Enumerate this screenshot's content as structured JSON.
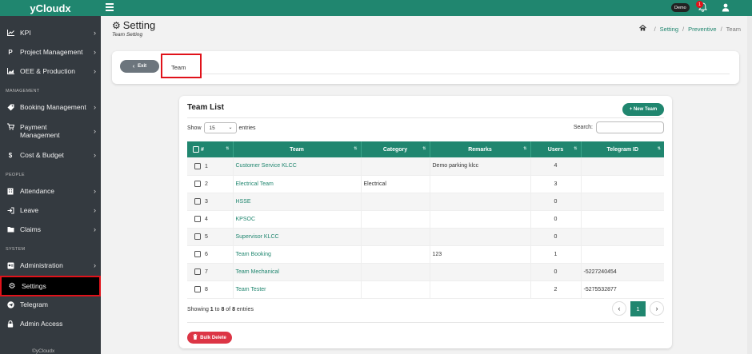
{
  "app": {
    "brand": "yCloudx",
    "footer": "©yCloudx"
  },
  "topbar": {
    "demo_label": "Demo",
    "notification_count": "1"
  },
  "sidebar": {
    "items": [
      {
        "label": "KPI",
        "icon": "chart-line-icon",
        "chevron": true
      },
      {
        "label": "Project Management",
        "icon": "parking-icon",
        "chevron": true
      },
      {
        "label": "OEE & Production",
        "icon": "chart-area-icon",
        "chevron": true
      },
      {
        "label": "Booking Management",
        "icon": "tag-icon",
        "chevron": true
      },
      {
        "label": "Payment Management",
        "icon": "cart-icon",
        "chevron": true
      },
      {
        "label": "Cost & Budget",
        "icon": "dollar-icon",
        "chevron": true
      },
      {
        "label": "Attendance",
        "icon": "building-icon",
        "chevron": true
      },
      {
        "label": "Leave",
        "icon": "login-icon",
        "chevron": true
      },
      {
        "label": "Claims",
        "icon": "folder-icon",
        "chevron": true
      },
      {
        "label": "Administration",
        "icon": "id-card-icon",
        "chevron": true
      },
      {
        "label": "Settings",
        "icon": "gear-icon",
        "chevron": false
      },
      {
        "label": "Telegram",
        "icon": "telegram-icon",
        "chevron": false
      },
      {
        "label": "Admin Access",
        "icon": "lock-icon",
        "chevron": false
      }
    ],
    "sections": [
      "MANAGEMENT",
      "PEOPLE",
      "SYSTEM"
    ]
  },
  "page": {
    "title": "Setting",
    "subtitle": "Team Setting",
    "breadcrumb": [
      "Setting",
      "Preventive",
      "Team"
    ]
  },
  "exit_bar": {
    "exit_label": "Exit",
    "tab_label": "Team"
  },
  "team_list": {
    "title": "Team List",
    "new_button": "+ New Team",
    "show_label": "Show",
    "entries_value": "15",
    "entries_label": "entries",
    "search_label": "Search:",
    "columns": [
      "#",
      "Team",
      "Category",
      "Remarks",
      "Users",
      "Telegram ID"
    ],
    "rows": [
      {
        "num": "1",
        "team": "Customer Service KLCC",
        "category": "",
        "remarks": "Demo parking klcc",
        "users": "4",
        "telegram": ""
      },
      {
        "num": "2",
        "team": "Electrical Team",
        "category": "Electrical",
        "remarks": "",
        "users": "3",
        "telegram": ""
      },
      {
        "num": "3",
        "team": "HSSE",
        "category": "",
        "remarks": "",
        "users": "0",
        "telegram": ""
      },
      {
        "num": "4",
        "team": "KPSOC",
        "category": "",
        "remarks": "",
        "users": "0",
        "telegram": ""
      },
      {
        "num": "5",
        "team": "Supervisor KLCC",
        "category": "",
        "remarks": "",
        "users": "0",
        "telegram": ""
      },
      {
        "num": "6",
        "team": "Team Booking",
        "category": "",
        "remarks": "123",
        "users": "1",
        "telegram": ""
      },
      {
        "num": "7",
        "team": "Team Mechanical",
        "category": "",
        "remarks": "",
        "users": "0",
        "telegram": "-5227240454"
      },
      {
        "num": "8",
        "team": "Team Tester",
        "category": "",
        "remarks": "",
        "users": "2",
        "telegram": "-5275532877"
      }
    ],
    "info_prefix": "Showing ",
    "info_from": "1",
    "info_to_word": " to ",
    "info_to": "8",
    "info_of_word": " of ",
    "info_total": "8",
    "info_suffix": " entries",
    "current_page": "1",
    "bulk_delete": "Bulk Delete"
  },
  "colors": {
    "accent": "#20866f",
    "danger": "#dc3545",
    "sidebar": "#343a40",
    "highlight": "#e0121a"
  }
}
